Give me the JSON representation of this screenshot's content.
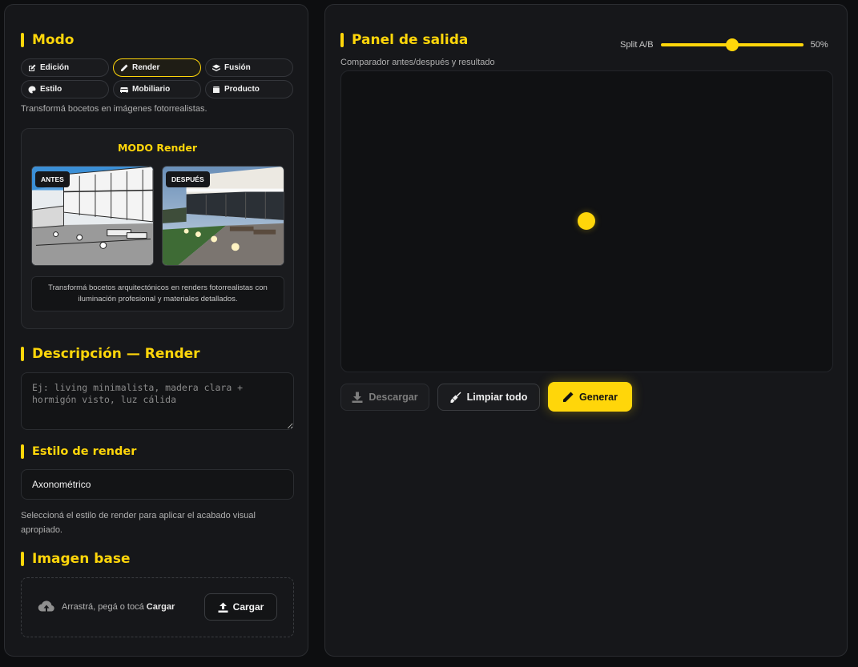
{
  "mode": {
    "title": "Modo",
    "buttons": [
      {
        "label": "Edición",
        "icon": "edit-icon"
      },
      {
        "label": "Render",
        "icon": "pencil-icon",
        "active": true
      },
      {
        "label": "Fusión",
        "icon": "layers-icon"
      },
      {
        "label": "Estilo",
        "icon": "palette-icon"
      },
      {
        "label": "Mobiliario",
        "icon": "sofa-icon"
      },
      {
        "label": "Producto",
        "icon": "box-icon"
      }
    ],
    "hint": "Transformá bocetos en imágenes fotorrealistas."
  },
  "preview": {
    "title": "MODO Render",
    "before_badge": "ANTES",
    "after_badge": "DESPUÉS",
    "description": "Transformá bocetos arquitectónicos en renders fotorrealistas con iluminación profesional y materiales detallados."
  },
  "description": {
    "title": "Descripción — Render",
    "placeholder": "Ej: living minimalista, madera clara + hormigón visto, luz cálida"
  },
  "render_style": {
    "title": "Estilo de render",
    "selected": "Axonométrico",
    "hint": "Seleccioná el estilo de render para aplicar el acabado visual apropiado."
  },
  "base_image": {
    "title": "Imagen base",
    "drop_text": "Arrastrá, pegá o tocá",
    "drop_text_bold": "Cargar",
    "upload_label": "Cargar"
  },
  "output": {
    "title": "Panel de salida",
    "subtitle": "Comparador antes/después y resultado",
    "split_label": "Split A/B",
    "split_value": "50%",
    "split_fraction": 0.5,
    "download_label": "Descargar",
    "clear_label": "Limpiar todo",
    "generate_label": "Generar"
  },
  "colors": {
    "accent": "#ffd60a",
    "background": "#0d0e10",
    "panel": "#16171a"
  }
}
